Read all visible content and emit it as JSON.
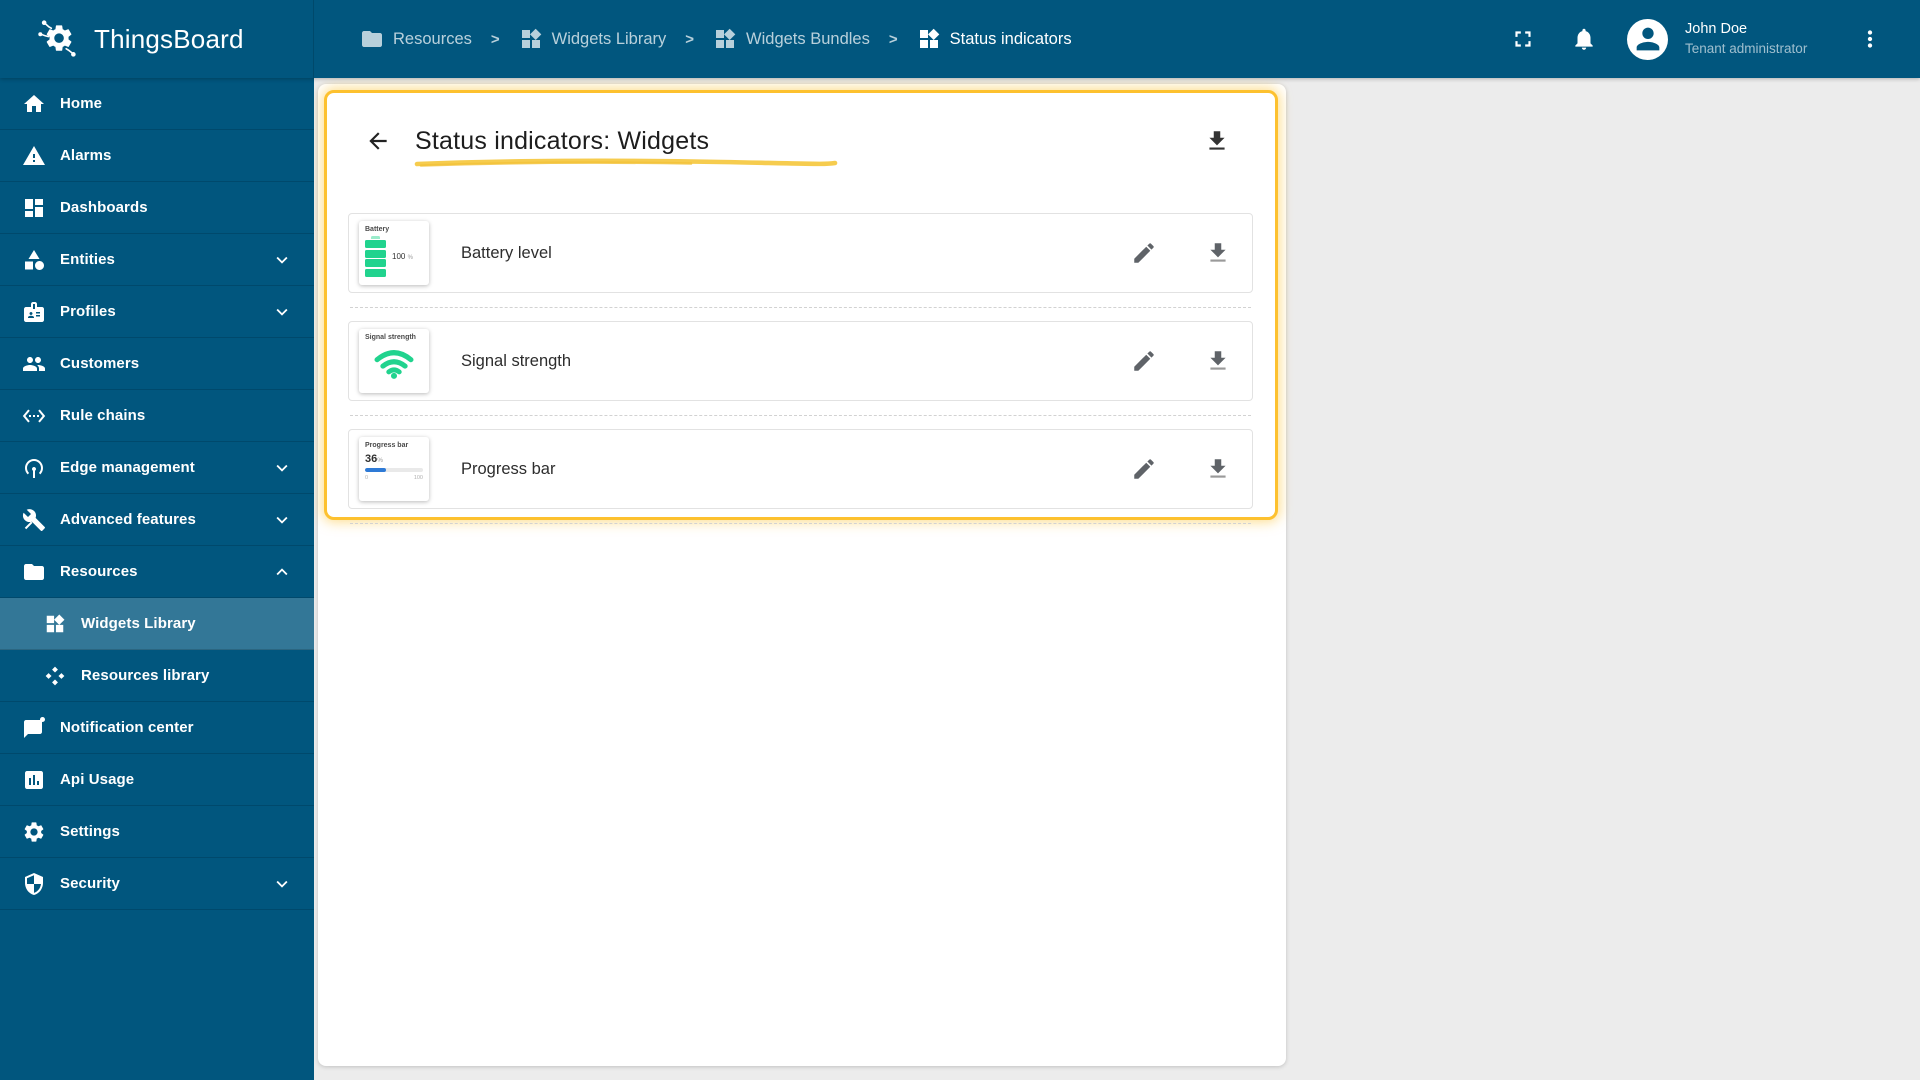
{
  "app": {
    "title": "ThingsBoard"
  },
  "breadcrumb": {
    "separator": ">",
    "items": [
      {
        "label": "Resources",
        "icon": "folder-icon",
        "active": false
      },
      {
        "label": "Widgets Library",
        "icon": "widgets-icon",
        "active": false
      },
      {
        "label": "Widgets Bundles",
        "icon": "widgets-icon",
        "active": false
      },
      {
        "label": "Status indicators",
        "icon": "widgets-icon",
        "active": true
      }
    ]
  },
  "user": {
    "name": "John Doe",
    "role": "Tenant administrator"
  },
  "sidebar": {
    "items": [
      {
        "label": "Home",
        "icon": "home-icon"
      },
      {
        "label": "Alarms",
        "icon": "warning-icon"
      },
      {
        "label": "Dashboards",
        "icon": "dashboard-icon"
      },
      {
        "label": "Entities",
        "icon": "category-icon",
        "chevron": "down"
      },
      {
        "label": "Profiles",
        "icon": "badge-icon",
        "chevron": "down"
      },
      {
        "label": "Customers",
        "icon": "people-icon"
      },
      {
        "label": "Rule chains",
        "icon": "code-brackets-icon"
      },
      {
        "label": "Edge management",
        "icon": "antenna-icon",
        "chevron": "down"
      },
      {
        "label": "Advanced features",
        "icon": "tools-icon",
        "chevron": "down"
      },
      {
        "label": "Resources",
        "icon": "folder-icon",
        "chevron": "up"
      },
      {
        "label": "Widgets Library",
        "icon": "widgets-icon",
        "sub": true,
        "active": true
      },
      {
        "label": "Resources library",
        "icon": "diamonds-icon",
        "sub": true
      },
      {
        "label": "Notification center",
        "icon": "notification-message-icon"
      },
      {
        "label": "Api Usage",
        "icon": "chart-box-icon"
      },
      {
        "label": "Settings",
        "icon": "gear-icon"
      },
      {
        "label": "Security",
        "icon": "shield-icon",
        "chevron": "down"
      }
    ]
  },
  "panel": {
    "title": "Status indicators: Widgets",
    "widgets": [
      {
        "name": "Battery level",
        "preview": {
          "title": "Battery",
          "value": "100",
          "unit": "%"
        }
      },
      {
        "name": "Signal strength",
        "preview": {
          "title": "Signal strength"
        }
      },
      {
        "name": "Progress bar",
        "preview": {
          "title": "Progress bar",
          "value": "36",
          "unit": "%",
          "min": "0",
          "max": "100",
          "percent": "36"
        }
      }
    ]
  },
  "icons": {
    "logo": "gear-circuit",
    "header": [
      "fullscreen-icon",
      "bell-icon",
      "avatar-person-icon",
      "kebab-menu-icon"
    ],
    "card": [
      "back-arrow-icon",
      "download-icon"
    ],
    "row_actions": [
      "edit-pencil-icon",
      "download-icon"
    ]
  },
  "colors": {
    "header_bg": "#01567e",
    "sidebar_active": "rgba(255,255,255,0.2)",
    "highlight_yellow": "#fdc12f",
    "battery_green": "#21d38e",
    "progress_blue": "#2e7ad6",
    "content_bg": "#ececec"
  }
}
